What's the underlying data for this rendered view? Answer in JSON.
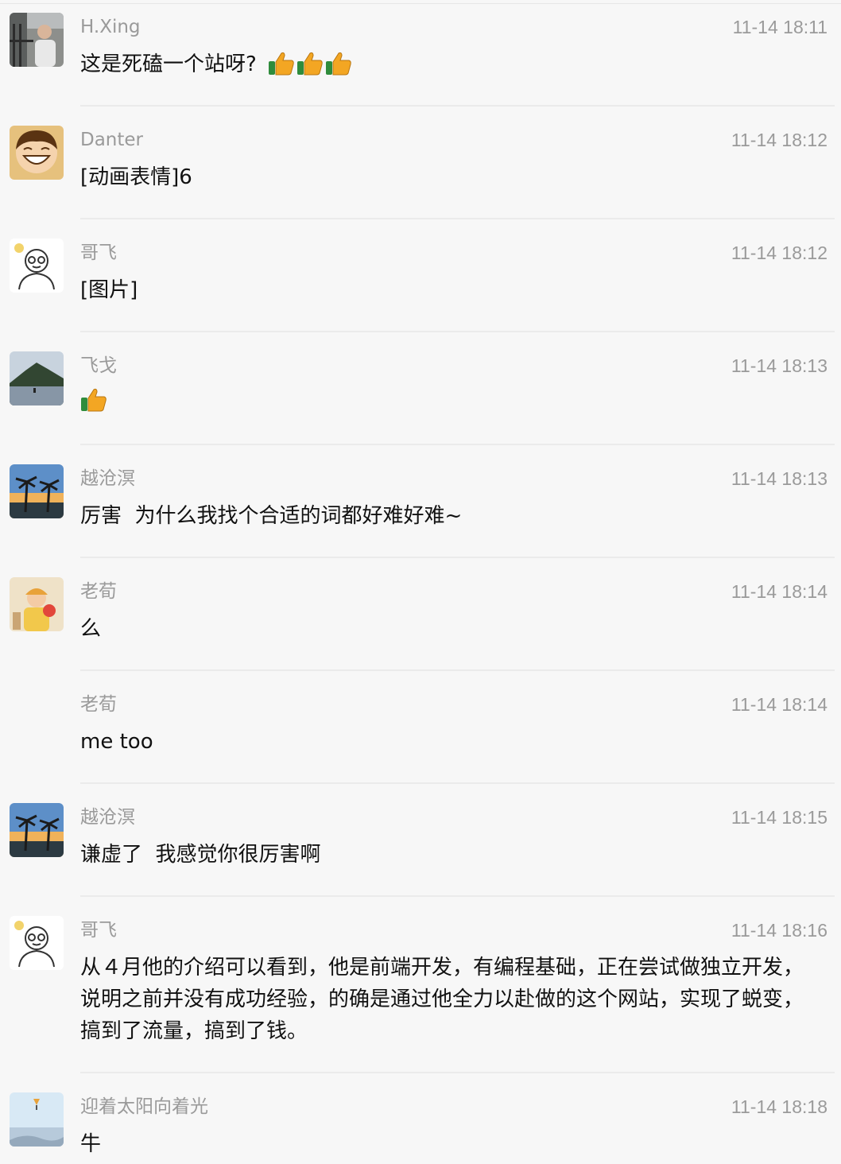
{
  "messages": [
    {
      "name": "H.Xing",
      "time": "11-14 18:11",
      "text": "这是死磕一个站呀?",
      "emoji": [
        "thumbs-up-icon",
        "thumbs-up-icon",
        "thumbs-up-icon"
      ],
      "avatar": "avatar-photo-man-balcony"
    },
    {
      "name": "Danter",
      "time": "11-14 18:12",
      "text": "[动画表情]6",
      "avatar": "avatar-cartoon-boy-smiling"
    },
    {
      "name": "哥飞",
      "time": "11-14 18:12",
      "text": "[图片]",
      "avatar": "avatar-sketch-man-glasses"
    },
    {
      "name": "飞戈",
      "time": "11-14 18:13",
      "text": "",
      "emoji": [
        "thumbs-up-icon"
      ],
      "avatar": "avatar-photo-mountain-lake"
    },
    {
      "name": "越沧溟",
      "time": "11-14 18:13",
      "text": "厉害  为什么我找个合适的词都好难好难~",
      "avatar": "avatar-photo-palm-trees"
    },
    {
      "name": "老荀",
      "time": "11-14 18:14",
      "text": "么",
      "avatar": "avatar-photo-child"
    },
    {
      "name": "老荀",
      "time": "11-14 18:14",
      "text": "me too",
      "avatar": ""
    },
    {
      "name": "越沧溟",
      "time": "11-14 18:15",
      "text": "谦虚了  我感觉你很厉害啊",
      "avatar": "avatar-photo-palm-trees"
    },
    {
      "name": "哥飞",
      "time": "11-14 18:16",
      "text": "从４月他的介绍可以看到，他是前端开发，有编程基础，正在尝试做独立开发，说明之前并没有成功经验，的确是通过他全力以赴做的这个网站，实现了蜕变，搞到了流量，搞到了钱。",
      "avatar": "avatar-sketch-man-glasses"
    },
    {
      "name": "迎着太阳向着光",
      "time": "11-14 18:18",
      "text": "牛",
      "avatar": "avatar-photo-sky-kite"
    }
  ],
  "colors": {
    "background": "#f7f7f7",
    "meta_text": "#9a9a9a",
    "body_text": "#111111",
    "separator": "#ebebeb"
  }
}
